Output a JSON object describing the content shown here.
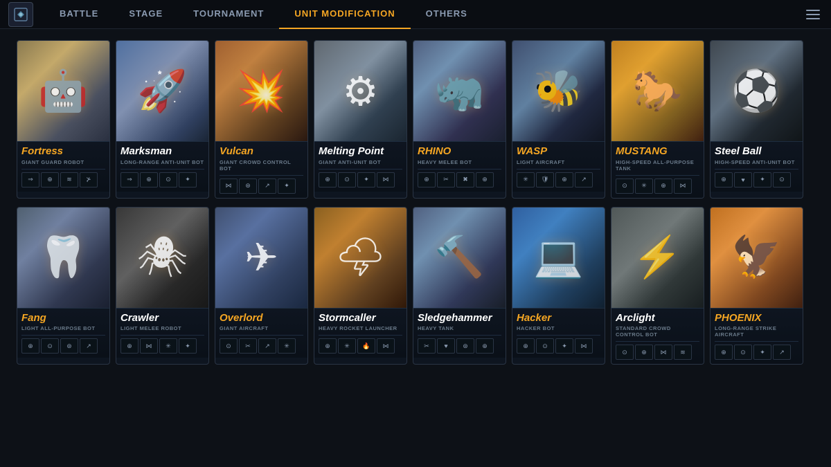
{
  "nav": {
    "logo_label": "Game Logo",
    "items": [
      {
        "id": "battle",
        "label": "BATTLE",
        "active": false
      },
      {
        "id": "stage",
        "label": "STAGE",
        "active": false
      },
      {
        "id": "tournament",
        "label": "TOURNAMENT",
        "active": false
      },
      {
        "id": "unit-modification",
        "label": "UNIT MODIFICATION",
        "active": true
      },
      {
        "id": "others",
        "label": "OTHERS",
        "active": false
      }
    ],
    "menu_label": "Menu"
  },
  "units_row1": [
    {
      "id": "fortress",
      "name": "Fortress",
      "name_style": "orange",
      "type": "GIANT GUARD ROBOT",
      "gradient": "gradient-fortress",
      "emoji": "🤖",
      "skills": [
        "⇒",
        "⊕",
        "≋",
        "⊁",
        "",
        "",
        "",
        ""
      ]
    },
    {
      "id": "marksman",
      "name": "Marksman",
      "name_style": "white",
      "type": "LONG-RANGE ANTI-UNIT BOT",
      "gradient": "gradient-marksman",
      "emoji": "🚀",
      "skills": [
        "⇒",
        "⊕",
        "⊙",
        "✦",
        "",
        "",
        "",
        ""
      ]
    },
    {
      "id": "vulcan",
      "name": "Vulcan",
      "name_style": "orange",
      "type": "GIANT CROWD CONTROL BOT",
      "gradient": "gradient-vulcan",
      "emoji": "💥",
      "skills": [
        "⋈",
        "⊛",
        "↗",
        "✦",
        "",
        "",
        "",
        ""
      ]
    },
    {
      "id": "meltingpoint",
      "name": "Melting Point",
      "name_style": "white",
      "type": "GIANT ANTI-UNIT BOT",
      "gradient": "gradient-meltingpoint",
      "emoji": "⚙",
      "skills": [
        "⊕",
        "⊙",
        "✦",
        "⋈",
        "",
        "",
        "",
        ""
      ]
    },
    {
      "id": "rhino",
      "name": "RHINO",
      "name_style": "orange",
      "type": "HEAVY MELEE BOT",
      "gradient": "gradient-rhino",
      "emoji": "🦏",
      "skills": [
        "⊕",
        "✂",
        "✖",
        "⊕",
        "",
        "",
        "",
        ""
      ]
    },
    {
      "id": "wasp",
      "name": "WASP",
      "name_style": "orange",
      "type": "LIGHT AIRCRAFT",
      "gradient": "gradient-wasp",
      "emoji": "🐝",
      "skills": [
        "✳",
        "🛡",
        "⊕",
        "↗",
        "",
        "",
        "",
        ""
      ]
    },
    {
      "id": "mustang",
      "name": "MUSTANG",
      "name_style": "orange",
      "type": "HIGH-SPEED ALL-PURPOSE TANK",
      "gradient": "gradient-mustang",
      "emoji": "🐎",
      "skills": [
        "⊙",
        "✳",
        "⊕",
        "⋈",
        "",
        "",
        "",
        ""
      ]
    },
    {
      "id": "steelball",
      "name": "Steel Ball",
      "name_style": "white",
      "type": "HIGH-SPEED ANTI-UNIT BOT",
      "gradient": "gradient-steelball",
      "emoji": "⚽",
      "skills": [
        "⊕",
        "♥",
        "✦",
        "⊙",
        "",
        "",
        "",
        ""
      ]
    }
  ],
  "units_row2": [
    {
      "id": "fang",
      "name": "Fang",
      "name_style": "orange",
      "type": "LIGHT ALL-PURPOSE BOT",
      "gradient": "gradient-fang",
      "emoji": "🦷",
      "skills": [
        "⊕",
        "⊙",
        "⊛",
        "↗",
        "",
        "",
        "",
        ""
      ]
    },
    {
      "id": "crawler",
      "name": "Crawler",
      "name_style": "white",
      "type": "LIGHT MELEE ROBOT",
      "gradient": "gradient-crawler",
      "emoji": "🕷",
      "skills": [
        "⊕",
        "⋈",
        "✳",
        "✦",
        "",
        "",
        "",
        ""
      ]
    },
    {
      "id": "overlord",
      "name": "Overlord",
      "name_style": "orange",
      "type": "GIANT AIRCRAFT",
      "gradient": "gradient-overlord",
      "emoji": "✈",
      "skills": [
        "⊙",
        "✂",
        "↗",
        "✳",
        "",
        "",
        "",
        ""
      ]
    },
    {
      "id": "stormcaller",
      "name": "Stormcaller",
      "name_style": "white",
      "type": "HEAVY ROCKET LAUNCHER",
      "gradient": "gradient-stormcaller",
      "emoji": "🌩",
      "skills": [
        "⊕",
        "✳",
        "🔥",
        "⋈",
        "",
        "",
        "",
        ""
      ]
    },
    {
      "id": "sledgehammer",
      "name": "Sledgehammer",
      "name_style": "white",
      "type": "HEAVY TANK",
      "gradient": "gradient-sledge",
      "emoji": "🔨",
      "skills": [
        "✂",
        "♥",
        "⊛",
        "⊕",
        "",
        "",
        "",
        ""
      ]
    },
    {
      "id": "hacker",
      "name": "Hacker",
      "name_style": "orange",
      "type": "HACKER BOT",
      "gradient": "gradient-hacker",
      "emoji": "💻",
      "skills": [
        "⊕",
        "⊙",
        "✦",
        "⋈",
        "",
        "",
        "",
        ""
      ]
    },
    {
      "id": "arclight",
      "name": "Arclight",
      "name_style": "white",
      "type": "STANDARD CROWD CONTROL BOT",
      "gradient": "gradient-arclight",
      "emoji": "⚡",
      "skills": [
        "⊙",
        "⊕",
        "⋈",
        "≋",
        "",
        "",
        "",
        ""
      ]
    },
    {
      "id": "phoenix",
      "name": "PHOENIX",
      "name_style": "orange",
      "type": "LONG-RANGE STRIKE AIRCRAFT",
      "gradient": "gradient-phoenix",
      "emoji": "🦅",
      "skills": [
        "⊕",
        "⊙",
        "✦",
        "↗",
        "",
        "",
        "",
        ""
      ]
    }
  ],
  "skill_icons": {
    "count": 4
  }
}
